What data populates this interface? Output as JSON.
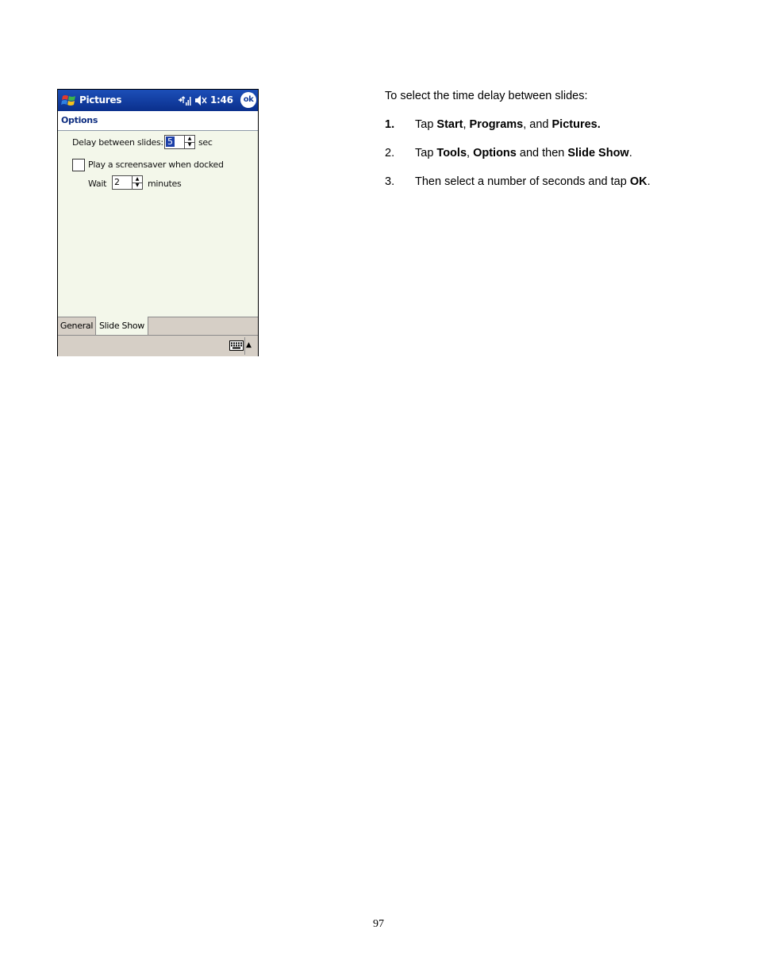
{
  "device_screen": {
    "title_bar": {
      "app_title": "Pictures",
      "clock": "1:46",
      "ok_label": "ok",
      "icons": [
        "windows-start-flag-icon",
        "connectivity-icon",
        "volume-icon"
      ]
    },
    "header": {
      "title": "Options"
    },
    "form": {
      "delay_label": "Delay between slides:",
      "delay_value": "5",
      "delay_unit": "sec",
      "screensaver_label": "Play a screensaver when docked",
      "screensaver_checked": false,
      "wait_label": "Wait",
      "wait_value": "2",
      "wait_unit": "minutes"
    },
    "tabs": [
      {
        "label": "General",
        "active": false
      },
      {
        "label": "Slide Show",
        "active": true
      }
    ],
    "menu_bar": {
      "icons": [
        "keyboard-icon",
        "arrow-up-icon"
      ]
    }
  },
  "instructions": {
    "intro": "To select the time delay between slides:",
    "steps": [
      {
        "number": "1.",
        "parts": [
          "Tap ",
          "Start",
          ", ",
          "Programs",
          ", and ",
          "Pictures."
        ]
      },
      {
        "number": "2.",
        "parts": [
          "Tap ",
          "Tools",
          ", ",
          "Options",
          " and then ",
          "Slide Show",
          "."
        ]
      },
      {
        "number": "3.",
        "parts": [
          "Then select a number of seconds and tap ",
          "OK",
          "."
        ]
      }
    ]
  },
  "page_number": "97",
  "colors": {
    "title_bar": "#0a2f8c",
    "header_text": "#0d2d80",
    "content_bg": "#f3f7ea",
    "tab_bar_bg": "#d6cfc6"
  }
}
